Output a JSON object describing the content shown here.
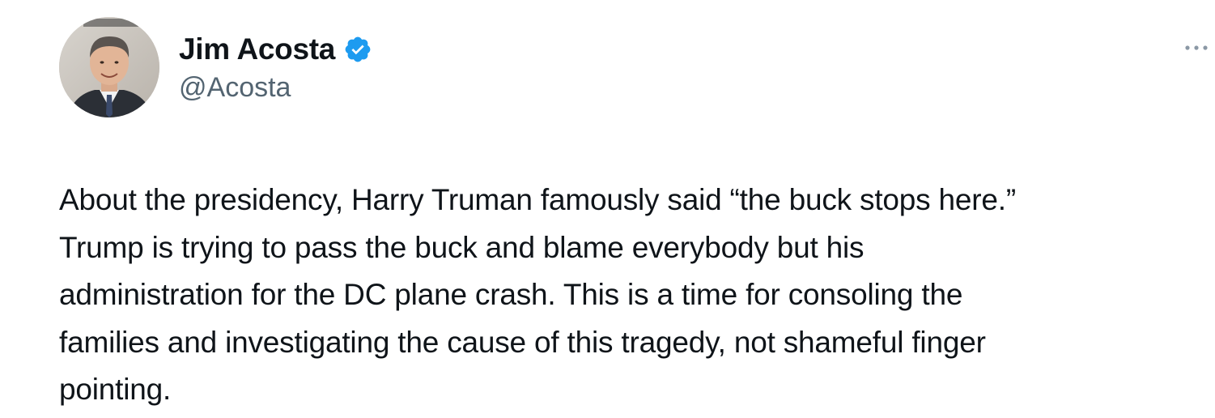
{
  "author": {
    "display_name": "Jim Acosta",
    "handle": "@Acosta",
    "verified": true,
    "avatar_icon": "profile-photo-man-in-suit"
  },
  "actions": {
    "more_icon": "more-horizontal-icon"
  },
  "tweet": {
    "text": "About the presidency, Harry Truman famously said “the buck stops here.”\nTrump is trying to pass the buck and blame everybody but his\nadministration for the DC plane crash. This is a time for consoling the\nfamilies and investigating the cause of this tragedy, not shameful finger\npointing."
  },
  "colors": {
    "text_primary": "#0f1419",
    "text_secondary": "#536471",
    "verified_blue": "#1d9bf0",
    "background": "#ffffff"
  }
}
